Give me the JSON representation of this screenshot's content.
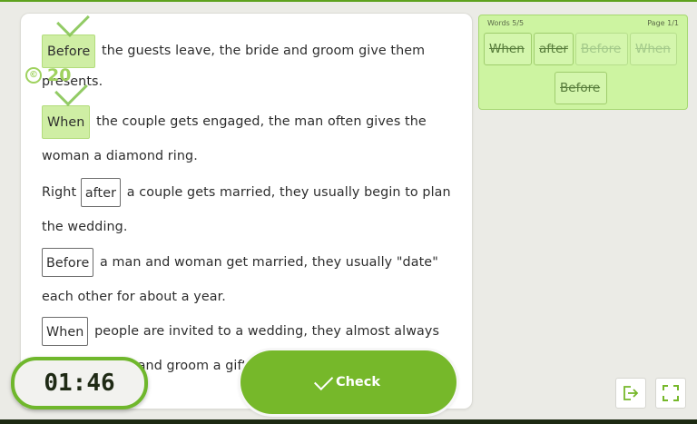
{
  "sentences": [
    {
      "gap": "Before",
      "text": "the guests leave, the bride and groom give them",
      "cont": "presents."
    },
    {
      "gap": "When",
      "text": "the couple gets engaged, the man often gives the",
      "cont": "woman a diamond ring."
    },
    {
      "pre": "Right",
      "gap": "after",
      "text": "a couple gets married, they usually begin to plan",
      "cont": "the wedding."
    },
    {
      "gap": "Before",
      "text": "a man and woman get married, they usually \"date\"",
      "cont": "each other for about a year."
    },
    {
      "gap": "When",
      "text": "people are invited to a wedding, they almost always",
      "cont": "give the bride and groom a gift o"
    }
  ],
  "score": {
    "value": "20"
  },
  "word_bank": {
    "words_counter": "Words 5/5",
    "page_counter": "Page 1/1",
    "chips": [
      "When",
      "after",
      "Before",
      "When",
      "Before"
    ]
  },
  "timer": {
    "value": "01:46"
  },
  "check_button": {
    "label": "Check"
  },
  "colors": {
    "accent": "#76b82a",
    "bank_bg": "#cdf4a1",
    "correct_bg": "#cfeea4"
  }
}
